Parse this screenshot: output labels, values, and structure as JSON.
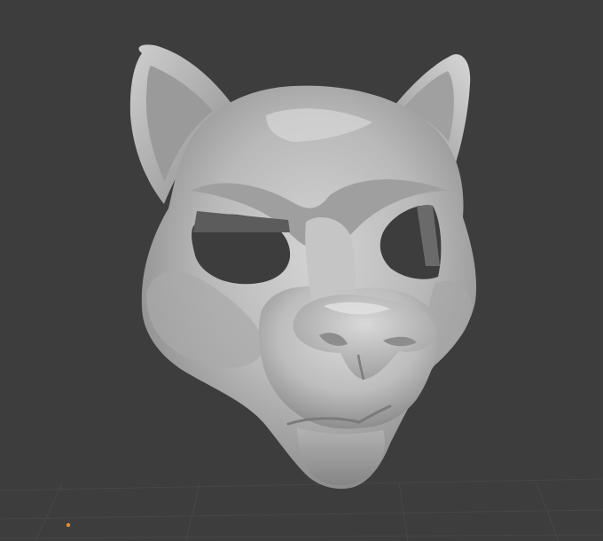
{
  "viewport": {
    "background_color": "#3d3d3d",
    "grid_color": "#4a4a4a",
    "model_base_color": "#b9b9b9",
    "model_shadow_color": "#6f6f6f",
    "model_highlight_color": "#dcdcdc",
    "origin_marker_color": "#e0902e"
  },
  "scene": {
    "object": "sculpted-cat-mask",
    "icons": [
      "origin-dot-icon"
    ]
  }
}
